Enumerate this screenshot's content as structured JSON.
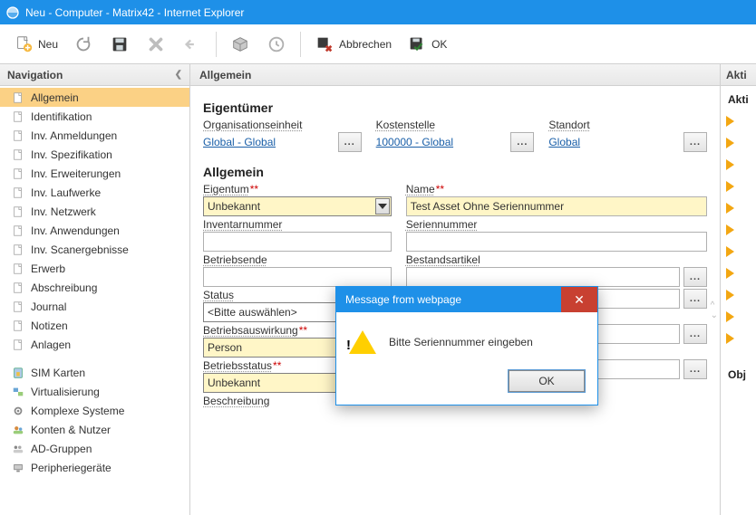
{
  "window": {
    "title": "Neu - Computer - Matrix42 - Internet Explorer"
  },
  "toolbar": {
    "neu": "Neu",
    "abbrechen": "Abbrechen",
    "ok": "OK"
  },
  "nav": {
    "header": "Navigation",
    "items": [
      {
        "label": "Allgemein",
        "icon": "doc",
        "active": true
      },
      {
        "label": "Identifikation",
        "icon": "doc"
      },
      {
        "label": "Inv. Anmeldungen",
        "icon": "doc"
      },
      {
        "label": "Inv. Spezifikation",
        "icon": "doc"
      },
      {
        "label": "Inv. Erweiterungen",
        "icon": "doc"
      },
      {
        "label": "Inv. Laufwerke",
        "icon": "doc"
      },
      {
        "label": "Inv. Netzwerk",
        "icon": "doc"
      },
      {
        "label": "Inv. Anwendungen",
        "icon": "doc"
      },
      {
        "label": "Inv. Scanergebnisse",
        "icon": "doc"
      },
      {
        "label": "Erwerb",
        "icon": "doc"
      },
      {
        "label": "Abschreibung",
        "icon": "doc"
      },
      {
        "label": "Journal",
        "icon": "doc"
      },
      {
        "label": "Notizen",
        "icon": "doc"
      },
      {
        "label": "Anlagen",
        "icon": "doc"
      }
    ],
    "items2": [
      {
        "label": "SIM Karten",
        "icon": "sim"
      },
      {
        "label": "Virtualisierung",
        "icon": "virt"
      },
      {
        "label": "Komplexe Systeme",
        "icon": "gear"
      },
      {
        "label": "Konten & Nutzer",
        "icon": "users"
      },
      {
        "label": "AD-Gruppen",
        "icon": "group"
      },
      {
        "label": "Peripheriegeräte",
        "icon": "periph"
      }
    ]
  },
  "main": {
    "header": "Allgemein",
    "owner_section": "Eigentümer",
    "org_unit_label": "Organisationseinheit",
    "org_unit_value": "Global - Global",
    "cost_center_label": "Kostenstelle",
    "cost_center_value": "100000 - Global",
    "location_label": "Standort",
    "location_value": "Global",
    "general_section": "Allgemein",
    "eigentum_label": "Eigentum",
    "eigentum_value": "Unbekannt",
    "name_label": "Name",
    "name_value": "Test Asset Ohne Seriennummer",
    "inventarnummer_label": "Inventarnummer",
    "seriennummer_label": "Seriennummer",
    "betriebsende_label": "Betriebsende",
    "bestandsartikel_label": "Bestandsartikel",
    "status_label": "Status",
    "status_value": "<Bitte auswählen>",
    "betriebsauswirkung_label": "Betriebsauswirkung",
    "betriebsauswirkung_value": "Person",
    "betriebsstatus_label": "Betriebsstatus",
    "betriebsstatus_value": "Unbekannt",
    "beschreibung_label": "Beschreibung",
    "browse": "..."
  },
  "aktionen": {
    "header": "Akti",
    "section1": "Akti",
    "section2": "Obj"
  },
  "dialog": {
    "title": "Message from webpage",
    "message": "Bitte Seriennummer eingeben",
    "ok": "OK"
  }
}
